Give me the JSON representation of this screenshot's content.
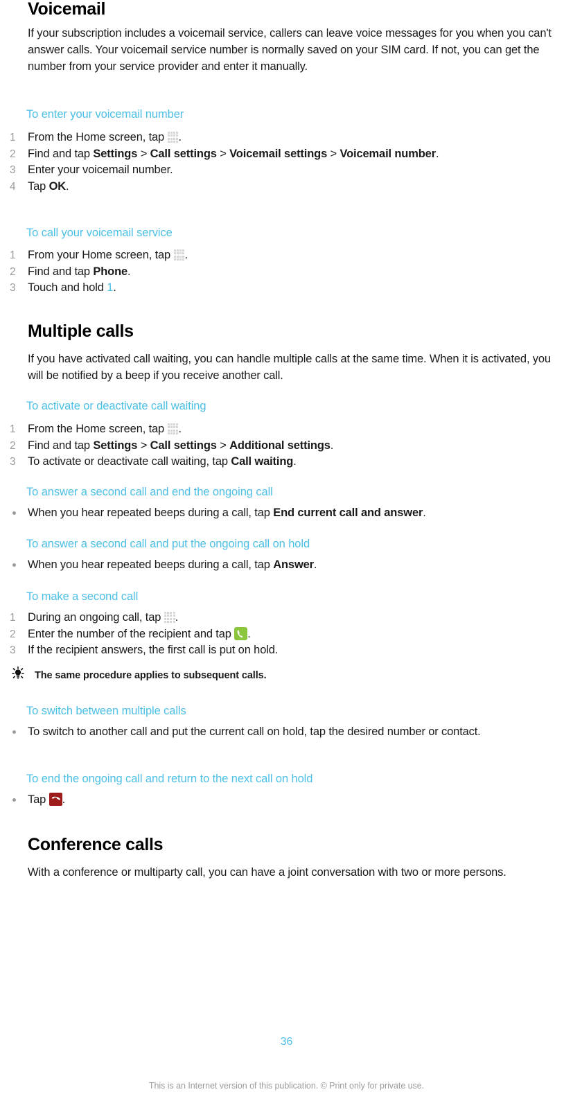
{
  "document": {
    "page_number": "36",
    "footer_note": "This is an Internet version of this publication. © Print only for private use.",
    "accent_color": "#4cbfe5",
    "text_color": "#1a1a1a",
    "marker_color": "#9b9b9b"
  },
  "sections": [
    {
      "title": "Voicemail",
      "intro": "If your subscription includes a voicemail service, callers can leave voice messages for you when you can't answer calls. Your voicemail service number is normally saved on your SIM card. If not, you can get the number from your service provider and enter it manually.",
      "procedures": [
        {
          "heading": "To enter your voicemail number",
          "steps": [
            {
              "num": "1",
              "pre": "From the Home screen, tap ",
              "icon": "app-drawer-icon",
              "post": "."
            },
            {
              "num": "2",
              "pre": "Find and tap ",
              "bold1": "Settings",
              "sep1": " > ",
              "bold2": "Call settings",
              "sep2": " > ",
              "bold3": "Voicemail settings",
              "sep3": " > ",
              "bold4": "Voicemail number",
              "post": "."
            },
            {
              "num": "3",
              "pre": "Enter your voicemail number."
            },
            {
              "num": "4",
              "pre": "Tap ",
              "bold1": "OK",
              "post": "."
            }
          ]
        },
        {
          "heading": "To call your voicemail service",
          "steps": [
            {
              "num": "1",
              "pre": "From your Home screen, tap ",
              "icon": "app-drawer-icon",
              "post": "."
            },
            {
              "num": "2",
              "pre": "Find and tap ",
              "bold1": "Phone",
              "post": "."
            },
            {
              "num": "3",
              "pre": "Touch and hold ",
              "cyan": "1",
              "post": "."
            }
          ]
        }
      ]
    },
    {
      "title": "Multiple calls",
      "intro": "If you have activated call waiting, you can handle multiple calls at the same time. When it is activated, you will be notified by a beep if you receive another call.",
      "procedures": [
        {
          "heading": "To activate or deactivate call waiting",
          "steps": [
            {
              "num": "1",
              "pre": "From the Home screen, tap ",
              "icon": "app-drawer-icon",
              "post": "."
            },
            {
              "num": "2",
              "pre": "Find and tap ",
              "bold1": "Settings",
              "sep1": " > ",
              "bold2": "Call settings",
              "sep2": " > ",
              "bold3": "Additional settings",
              "post": "."
            },
            {
              "num": "3",
              "pre": "To activate or deactivate call waiting, tap ",
              "bold1": "Call waiting",
              "post": "."
            }
          ]
        },
        {
          "heading": "To answer a second call and end the ongoing call",
          "bullets": [
            {
              "pre": "When you hear repeated beeps during a call, tap ",
              "bold1": "End current call and answer",
              "post": "."
            }
          ]
        },
        {
          "heading": "To answer a second call and put the ongoing call on hold",
          "bullets": [
            {
              "pre": "When you hear repeated beeps during a call, tap ",
              "bold1": "Answer",
              "post": "."
            }
          ]
        },
        {
          "heading": "To make a second call",
          "steps": [
            {
              "num": "1",
              "pre": "During an ongoing call, tap ",
              "icon": "app-drawer-icon",
              "post": "."
            },
            {
              "num": "2",
              "pre": "Enter the number of the recipient and tap ",
              "icon": "call-green-icon",
              "post": "."
            },
            {
              "num": "3",
              "pre": "If the recipient answers, the first call is put on hold."
            }
          ],
          "tip": "The same procedure applies to subsequent calls."
        },
        {
          "heading": "To switch between multiple calls",
          "bullets": [
            {
              "pre": "To switch to another call and put the current call on hold, tap the desired number or contact."
            }
          ]
        },
        {
          "heading": "To end the ongoing call and return to the next call on hold",
          "bullets": [
            {
              "pre": "Tap ",
              "icon": "end-call-red-icon",
              "post": "."
            }
          ]
        }
      ]
    },
    {
      "title": "Conference calls",
      "intro": "With a conference or multiparty call, you can have a joint conversation with two or more persons."
    }
  ]
}
